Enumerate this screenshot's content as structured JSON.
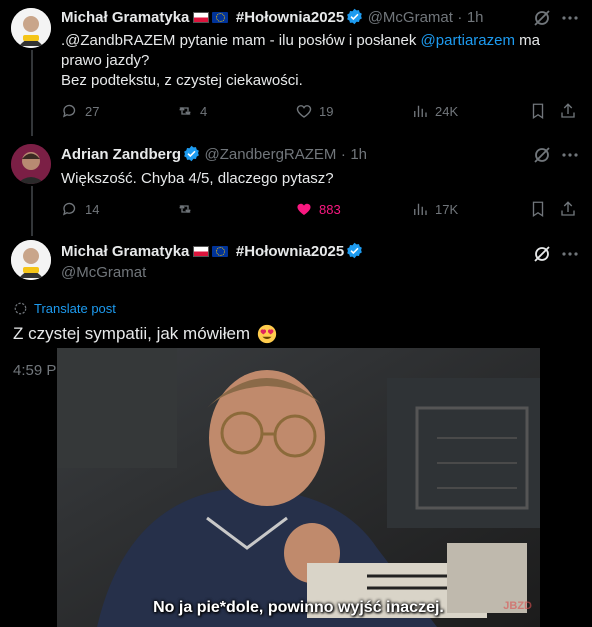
{
  "thread": [
    {
      "author": "Michał Gramatyka",
      "hashtag": "#Hołownia2025",
      "handle": "@McGramat",
      "time": "1h",
      "text_prefix": ".@ZandbRAZEM pytanie mam - ilu posłów i posłanek ",
      "mention": "@partiarazem",
      "text_suffix": " ma prawo jazdy?",
      "text_line2": "Bez podtekstu, z czystej ciekawości.",
      "replies": "27",
      "reposts": "4",
      "likes": "19",
      "views": "24K"
    },
    {
      "author": "Adrian Zandberg",
      "handle": "@ZandbergRAZEM",
      "time": "1h",
      "text": "Większość. Chyba 4/5, dlaczego pytasz?",
      "replies": "14",
      "reposts": "",
      "likes": "883",
      "views": "17K"
    }
  ],
  "main": {
    "author": "Michał Gramatyka",
    "hashtag": "#Hołownia2025",
    "handle": "@McGramat",
    "translate": "Translate post",
    "text": "Z czystej sympatii, jak mówiłem",
    "time": "4:59 P",
    "subtitle": "No ja pie*dole, powinno wyjść inaczej."
  },
  "icons": {
    "more": "more-icon",
    "grok": "grok-icon",
    "reply": "reply-icon",
    "repost": "repost-icon",
    "like": "heart-icon",
    "views": "views-icon",
    "bookmark": "bookmark-icon",
    "share": "share-icon",
    "globe": "translate-icon"
  },
  "colors": {
    "accent": "#1d9bf0",
    "like_active": "#f91880",
    "muted": "#71767b"
  }
}
